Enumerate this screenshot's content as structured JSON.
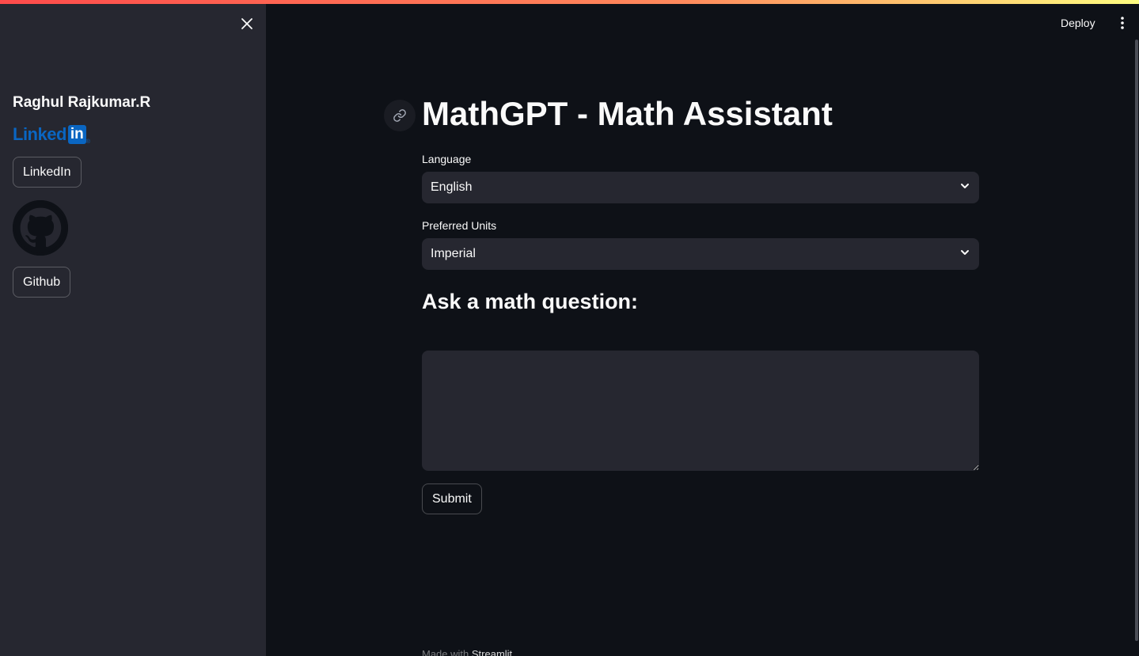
{
  "header": {
    "deploy_label": "Deploy",
    "menu_icon": "more-vertical-icon"
  },
  "sidebar": {
    "close_icon": "close-icon",
    "author_name": "Raghul Rajkumar.R",
    "linkedin_logo": {
      "word": "Linked",
      "box": "in"
    },
    "linkedin_button": "LinkedIn",
    "github_icon": "github-icon",
    "github_button": "Github"
  },
  "main": {
    "anchor_icon": "link-icon",
    "title": "MathGPT - Math Assistant",
    "language": {
      "label": "Language",
      "value": "English"
    },
    "units": {
      "label": "Preferred Units",
      "value": "Imperial"
    },
    "question_heading": "Ask a math question:",
    "question_value": "",
    "submit_label": "Submit"
  },
  "footer": {
    "prefix": "Made with",
    "brand": "Streamlit"
  },
  "colors": {
    "background": "#0e1117",
    "sidebar": "#262730",
    "linkedin": "#0a66c2",
    "accent_gradient": [
      "#ff4b4b",
      "#fffd80"
    ]
  }
}
